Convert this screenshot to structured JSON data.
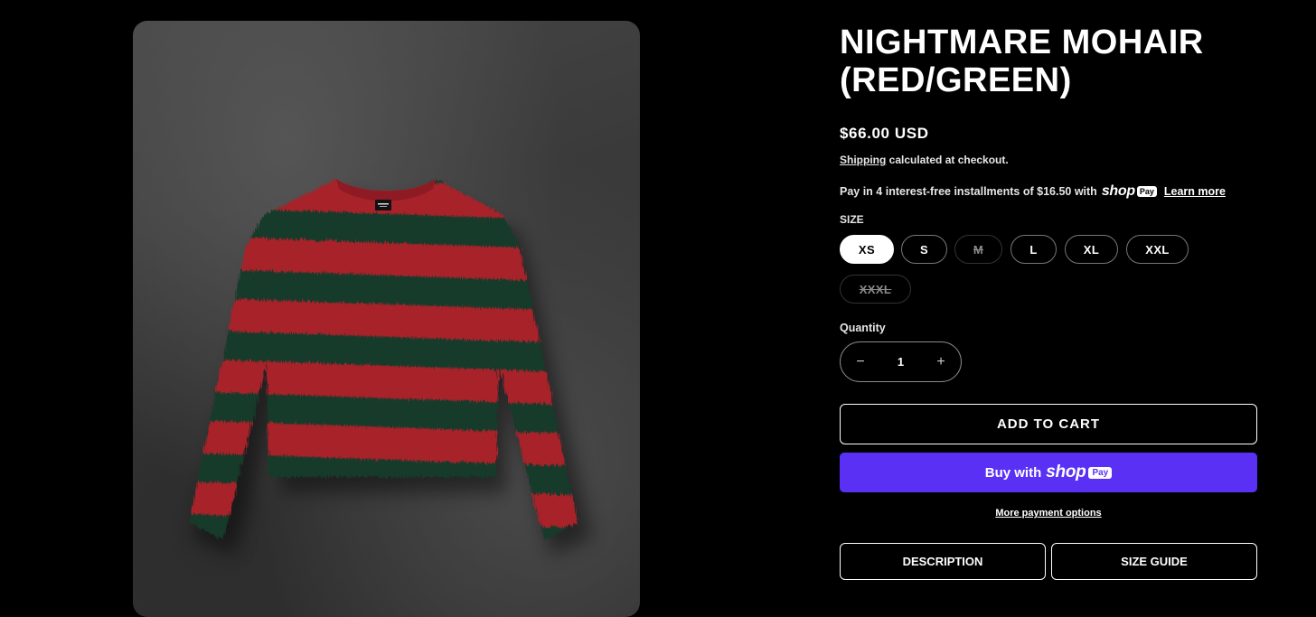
{
  "product": {
    "title": "NIGHTMARE MOHAIR (RED/GREEN)",
    "price": "$66.00 USD",
    "shipping_link": "Shipping",
    "shipping_note": " calculated at checkout.",
    "installments_text": "Pay in 4 interest-free installments of $16.50 with",
    "shop_logo": "shop",
    "pay_badge": "Pay",
    "learn_more": "Learn more",
    "image_label_icon": "sweater-photo",
    "colors": {
      "stripe_red": "#a8202c",
      "stripe_green": "#173b2c",
      "shop_pay": "#5a31f4"
    }
  },
  "size": {
    "label": "SIZE",
    "options": [
      {
        "label": "XS",
        "state": "selected"
      },
      {
        "label": "S",
        "state": "available"
      },
      {
        "label": "M",
        "state": "sold-out"
      },
      {
        "label": "L",
        "state": "available"
      },
      {
        "label": "XL",
        "state": "available"
      },
      {
        "label": "XXL",
        "state": "available"
      },
      {
        "label": "XXXL",
        "state": "sold-out"
      }
    ]
  },
  "quantity": {
    "label": "Quantity",
    "value": "1",
    "minus": "−",
    "plus": "+"
  },
  "actions": {
    "add_to_cart": "ADD TO CART",
    "buy_with": "Buy with",
    "buy_shop_logo": "shop",
    "buy_pay_badge": "Pay",
    "more_payment": "More payment options"
  },
  "tabs": {
    "description": "DESCRIPTION",
    "size_guide": "SIZE GUIDE"
  }
}
